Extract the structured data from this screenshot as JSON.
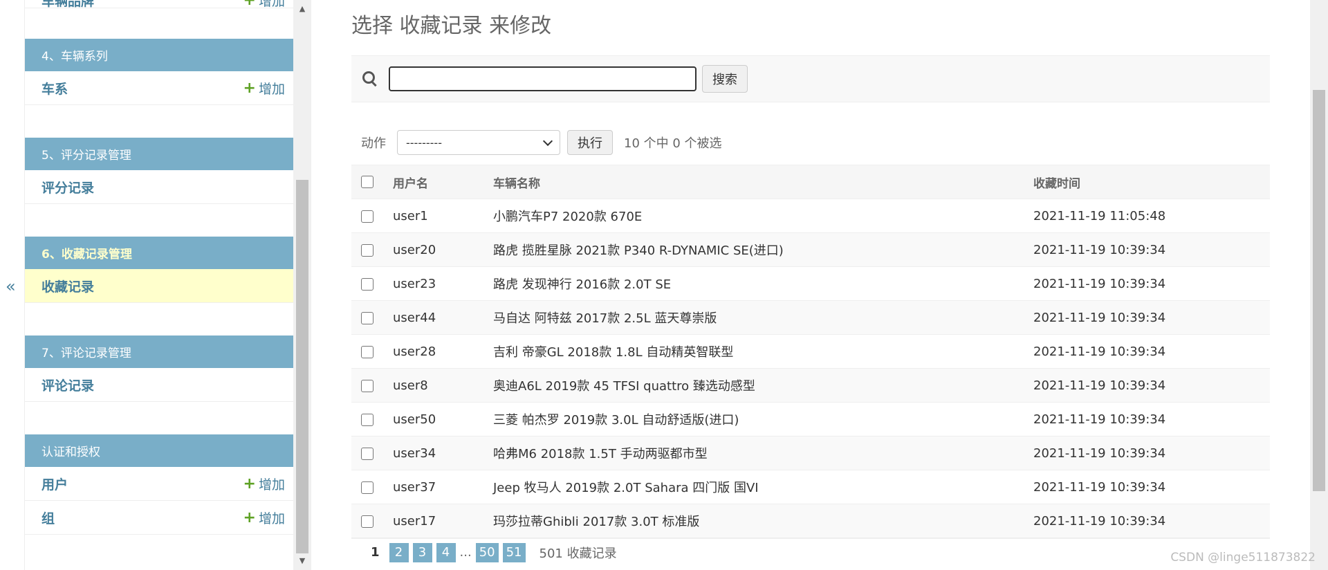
{
  "sidebar": {
    "toggle_glyph": "«",
    "top_partial_label": "车辆品牌",
    "top_partial_add": "增加",
    "modules": [
      {
        "header": "4、车辆系列",
        "rows": [
          {
            "label": "车系",
            "add": "增加"
          }
        ]
      },
      {
        "header": "5、评分记录管理",
        "rows": [
          {
            "label": "评分记录"
          }
        ]
      },
      {
        "header": "6、收藏记录管理",
        "rows": [
          {
            "label": "收藏记录"
          }
        ]
      },
      {
        "header": "7、评论记录管理",
        "rows": [
          {
            "label": "评论记录"
          }
        ]
      },
      {
        "header": "认证和授权",
        "rows": [
          {
            "label": "用户",
            "add": "增加"
          },
          {
            "label": "组",
            "add": "增加"
          }
        ]
      }
    ]
  },
  "main": {
    "title": "选择 收藏记录 来修改",
    "search": {
      "value": "",
      "button": "搜索"
    },
    "actions": {
      "label": "动作",
      "selected": "---------",
      "run_button": "执行",
      "counter": "10 个中 0 个被选"
    },
    "table": {
      "headers": {
        "user": "用户名",
        "car": "车辆名称",
        "time": "收藏时间"
      },
      "rows": [
        {
          "user": "user1",
          "car": "小鹏汽车P7 2020款 670E",
          "time": "2021-11-19 11:05:48"
        },
        {
          "user": "user20",
          "car": "路虎 揽胜星脉 2021款 P340 R-DYNAMIC SE(进口)",
          "time": "2021-11-19 10:39:34"
        },
        {
          "user": "user23",
          "car": "路虎 发现神行 2016款 2.0T SE",
          "time": "2021-11-19 10:39:34"
        },
        {
          "user": "user44",
          "car": "马自达 阿特兹 2017款 2.5L 蓝天尊崇版",
          "time": "2021-11-19 10:39:34"
        },
        {
          "user": "user28",
          "car": "吉利 帝豪GL 2018款 1.8L 自动精英智联型",
          "time": "2021-11-19 10:39:34"
        },
        {
          "user": "user8",
          "car": "奥迪A6L 2019款 45 TFSI quattro 臻选动感型",
          "time": "2021-11-19 10:39:34"
        },
        {
          "user": "user50",
          "car": "三菱 帕杰罗 2019款 3.0L 自动舒适版(进口)",
          "time": "2021-11-19 10:39:34"
        },
        {
          "user": "user34",
          "car": "哈弗M6 2018款 1.5T 手动两驱都市型",
          "time": "2021-11-19 10:39:34"
        },
        {
          "user": "user37",
          "car": "Jeep 牧马人 2019款 2.0T Sahara 四门版 国VI",
          "time": "2021-11-19 10:39:34"
        },
        {
          "user": "user17",
          "car": "玛莎拉蒂Ghibli 2017款 3.0T 标准版",
          "time": "2021-11-19 10:39:34"
        }
      ]
    },
    "paginator": {
      "current": "1",
      "pages": [
        "2",
        "3",
        "4"
      ],
      "ellipsis": "...",
      "last_pages": [
        "50",
        "51"
      ],
      "count": "501 收藏记录"
    }
  },
  "watermark": "CSDN @linge511873822",
  "colors": {
    "header_bg": "#79aec8",
    "link": "#447e9b",
    "selected_row": "#ffffcc",
    "add_plus": "#5fa225"
  }
}
